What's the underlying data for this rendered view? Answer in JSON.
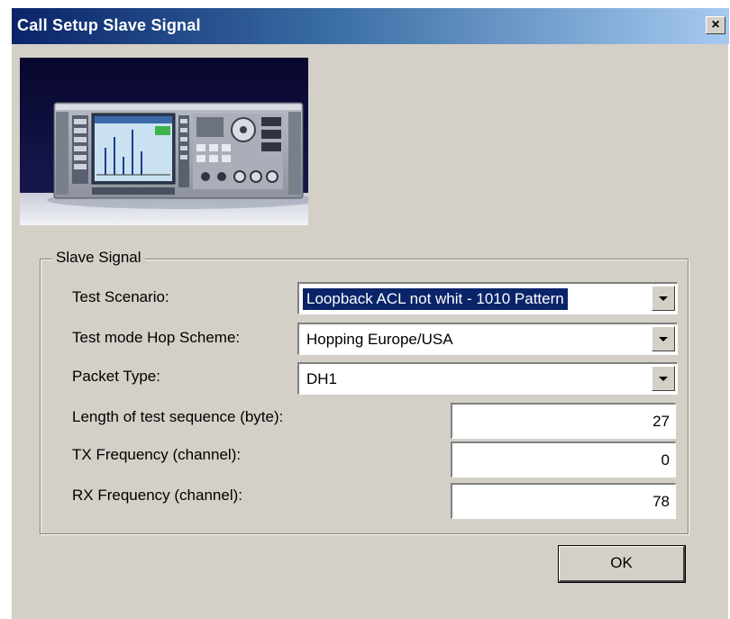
{
  "window": {
    "title": "Call Setup Slave Signal",
    "close_glyph": "×",
    "titlebar_color_start": "#0a246a",
    "titlebar_color_end": "#a6caf0",
    "background_color": "#d4d0c8"
  },
  "image": {
    "icon": "signal-tester-device-photo"
  },
  "slave_signal": {
    "group_label": "Slave Signal",
    "test_scenario": {
      "label": "Test Scenario:",
      "value": "Loopback ACL not whit - 1010 Pattern"
    },
    "hop_scheme": {
      "label": "Test mode Hop Scheme:",
      "value": "Hopping Europe/USA"
    },
    "packet_type": {
      "label": "Packet Type:",
      "value": "DH1"
    },
    "test_sequence_length": {
      "label": "Length of test sequence (byte):",
      "value": "27"
    },
    "tx_frequency": {
      "label": "TX Frequency (channel):",
      "value": "0"
    },
    "rx_frequency": {
      "label": "RX Frequency (channel):",
      "value": "78"
    }
  },
  "buttons": {
    "ok_label": "OK"
  }
}
